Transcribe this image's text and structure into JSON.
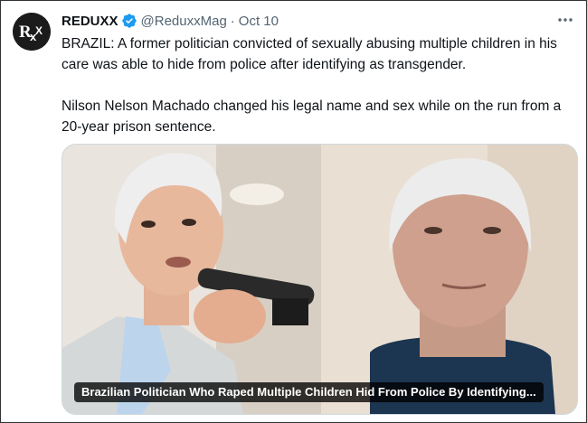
{
  "tweet": {
    "author_name": "REDUXX",
    "handle": "@ReduxxMag",
    "separator": "·",
    "date": "Oct 10",
    "paragraph_1": "BRAZIL: A former politician convicted of sexually abusing multiple children in his care was able to hide from police after identifying as transgender.",
    "paragraph_2": "Nilson Nelson Machado changed his legal name and sex while on the run from a 20-year prison sentence."
  },
  "avatar": {
    "logo_text": "RxX"
  },
  "card": {
    "caption": "Brazilian Politician Who Raped Multiple Children Hid From Police By Identifying..."
  },
  "colors": {
    "text_primary": "#0f1419",
    "text_secondary": "#536471",
    "verified_blue": "#1d9bf0",
    "border": "#cfd9de"
  },
  "icons": {
    "verified": "verified-badge-icon",
    "more": "more-options-icon"
  }
}
